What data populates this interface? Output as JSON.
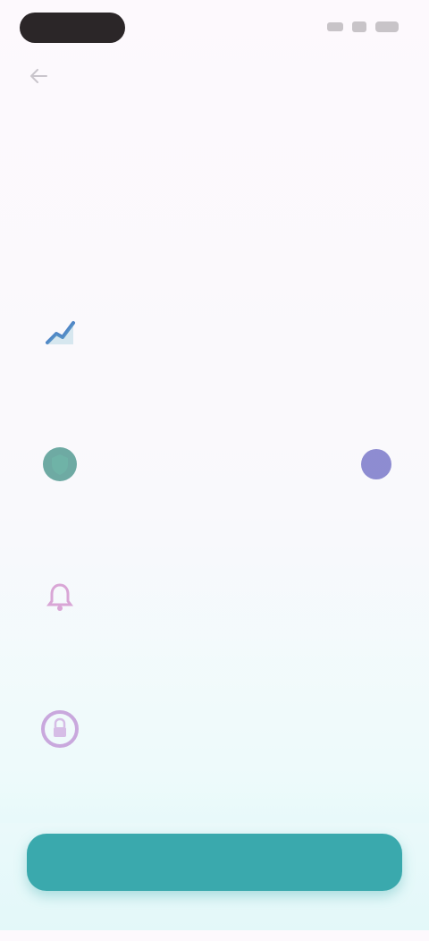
{
  "status_bar": {
    "time": ""
  },
  "header": {
    "title": "",
    "subtitle": ""
  },
  "features": [
    {
      "icon": "chart-trend-icon",
      "title": "",
      "description": ""
    },
    {
      "icon": "shield-icon",
      "title": "",
      "description": ""
    },
    {
      "icon": "bell-icon",
      "title": "",
      "description": ""
    },
    {
      "icon": "lock-icon",
      "title": "",
      "description": ""
    },
    {
      "icon": "star-icon",
      "title": "",
      "description": ""
    }
  ],
  "actions": {
    "continue_label": ""
  },
  "colors": {
    "accent": "#5b57c6",
    "primary_button": "#3aa9ad"
  }
}
